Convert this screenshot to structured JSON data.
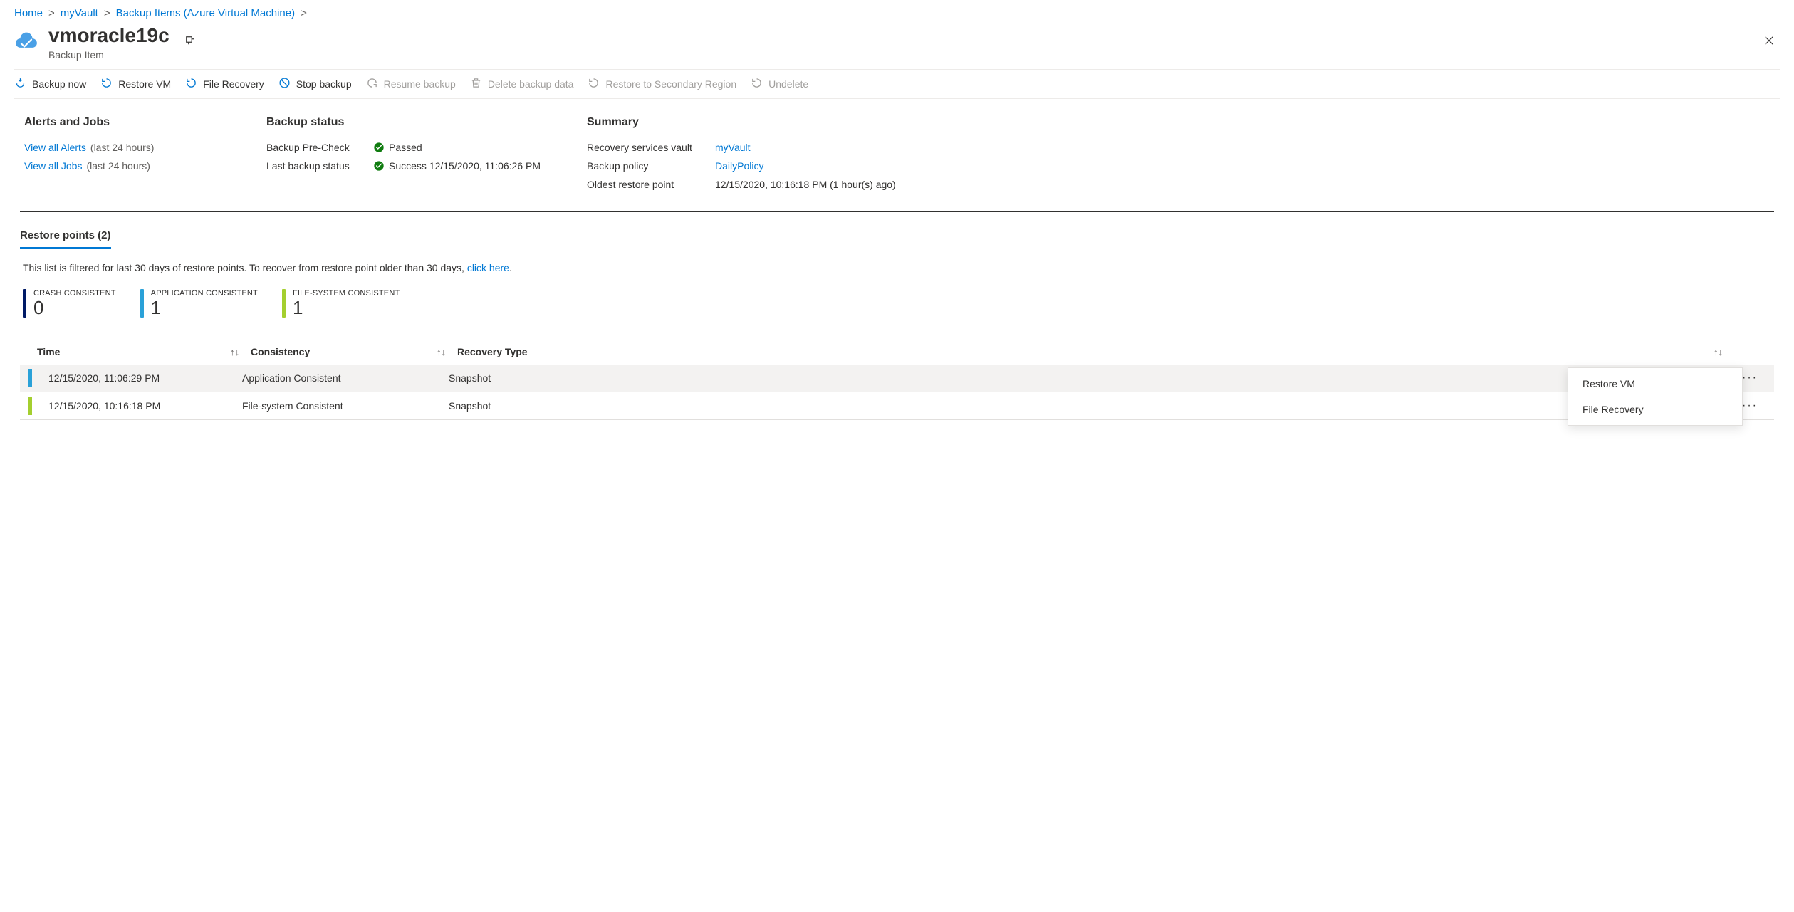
{
  "breadcrumb": {
    "home": "Home",
    "vault": "myVault",
    "items": "Backup Items (Azure Virtual Machine)"
  },
  "title": {
    "name": "vmoracle19c",
    "subtitle": "Backup Item"
  },
  "toolbar": {
    "backup_now": "Backup now",
    "restore_vm": "Restore VM",
    "file_recovery": "File Recovery",
    "stop_backup": "Stop backup",
    "resume_backup": "Resume backup",
    "delete_backup": "Delete backup data",
    "restore_secondary": "Restore to Secondary Region",
    "undelete": "Undelete"
  },
  "alerts": {
    "heading": "Alerts and Jobs",
    "view_alerts": "View all Alerts",
    "view_jobs": "View all Jobs",
    "hint": "(last 24 hours)"
  },
  "status": {
    "heading": "Backup status",
    "precheck_label": "Backup Pre-Check",
    "precheck_val": "Passed",
    "last_label": "Last backup status",
    "last_val": "Success 12/15/2020, 11:06:26 PM"
  },
  "summary": {
    "heading": "Summary",
    "vault_label": "Recovery services vault",
    "vault_val": "myVault",
    "policy_label": "Backup policy",
    "policy_val": "DailyPolicy",
    "oldest_label": "Oldest restore point",
    "oldest_val": "12/15/2020, 10:16:18 PM (1 hour(s) ago)"
  },
  "tab": {
    "label": "Restore points (2)"
  },
  "filter_note": {
    "text": "This list is filtered for last 30 days of restore points. To recover from restore point older than 30 days, ",
    "link": "click here"
  },
  "cards": {
    "crash": {
      "label": "CRASH CONSISTENT",
      "count": "0"
    },
    "app": {
      "label": "APPLICATION CONSISTENT",
      "count": "1"
    },
    "fs": {
      "label": "FILE-SYSTEM CONSISTENT",
      "count": "1"
    }
  },
  "columns": {
    "time": "Time",
    "consistency": "Consistency",
    "recovery": "Recovery Type"
  },
  "rows": [
    {
      "time": "12/15/2020, 11:06:29 PM",
      "consistency": "Application Consistent",
      "recovery": "Snapshot",
      "marker": "app"
    },
    {
      "time": "12/15/2020, 10:16:18 PM",
      "consistency": "File-system Consistent",
      "recovery": "Snapshot",
      "marker": "fs"
    }
  ],
  "context_menu": {
    "restore_vm": "Restore VM",
    "file_recovery": "File Recovery"
  }
}
